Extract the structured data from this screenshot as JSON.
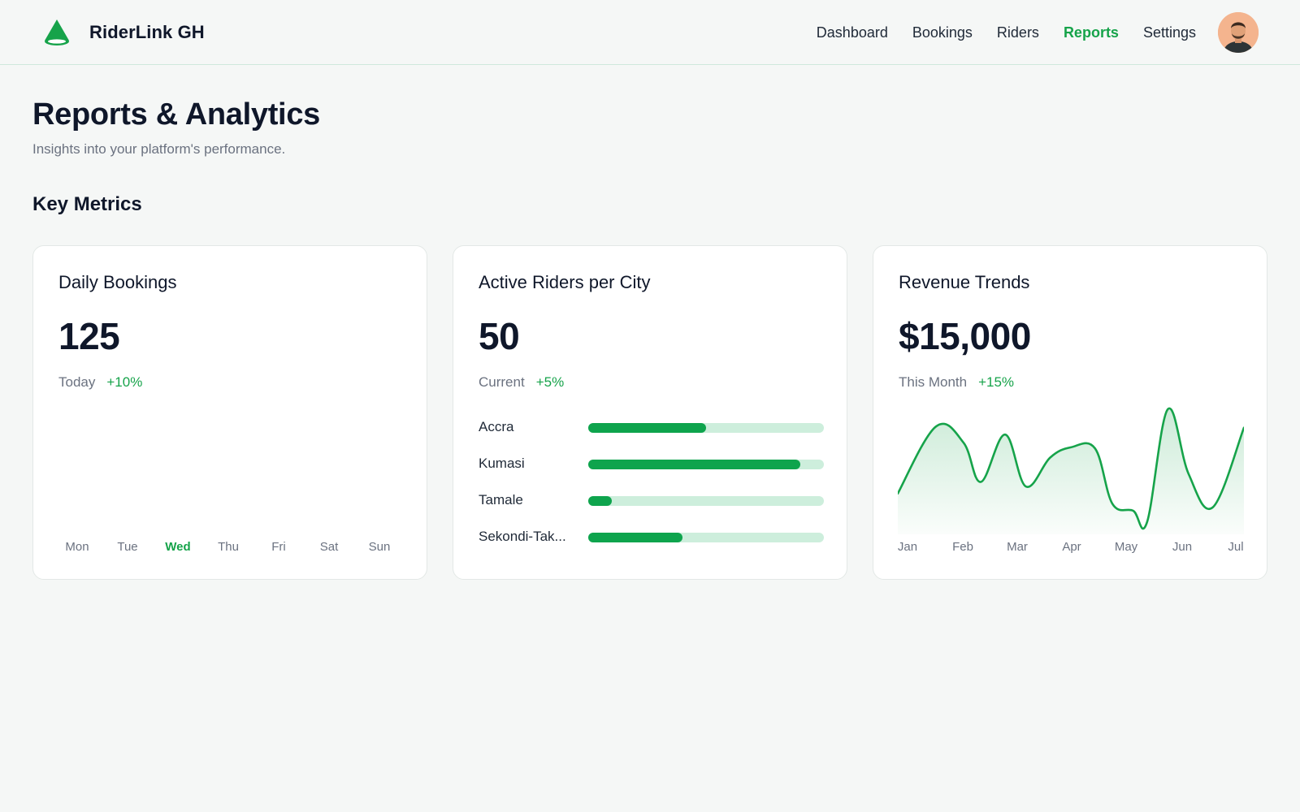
{
  "header": {
    "brand_name": "RiderLink GH",
    "nav": [
      {
        "label": "Dashboard",
        "active": false
      },
      {
        "label": "Bookings",
        "active": false
      },
      {
        "label": "Riders",
        "active": false
      },
      {
        "label": "Reports",
        "active": true
      },
      {
        "label": "Settings",
        "active": false
      }
    ],
    "accent_color": "#16a34a"
  },
  "page": {
    "title": "Reports & Analytics",
    "subtitle": "Insights into your platform's performance.",
    "section_title": "Key Metrics"
  },
  "cards": {
    "daily_bookings": {
      "title": "Daily Bookings",
      "value": "125",
      "period": "Today",
      "change": "+10%",
      "days": [
        "Mon",
        "Tue",
        "Wed",
        "Thu",
        "Fri",
        "Sat",
        "Sun"
      ],
      "active_day": "Wed"
    },
    "active_riders": {
      "title": "Active Riders per City",
      "value": "50",
      "period": "Current",
      "change": "+5%",
      "cities": [
        {
          "name": "Accra",
          "share": 0.5
        },
        {
          "name": "Kumasi",
          "share": 0.9
        },
        {
          "name": "Tamale",
          "share": 0.1
        },
        {
          "name": "Sekondi-Tak...",
          "share": 0.4
        }
      ]
    },
    "revenue": {
      "title": "Revenue Trends",
      "value": "$15,000",
      "period": "This Month",
      "change": "+15%"
    }
  },
  "chart_data": {
    "type": "area",
    "title": "Revenue Trends",
    "categories": [
      "Jan",
      "Feb",
      "Mar",
      "Apr",
      "May",
      "Jun",
      "Jul"
    ],
    "line_color": "#16a34a",
    "grid": false,
    "points": [
      {
        "x": 0.0,
        "y": 0.27
      },
      {
        "x": 0.11,
        "y": 0.85
      },
      {
        "x": 0.19,
        "y": 0.71
      },
      {
        "x": 0.24,
        "y": 0.37
      },
      {
        "x": 0.31,
        "y": 0.78
      },
      {
        "x": 0.37,
        "y": 0.33
      },
      {
        "x": 0.44,
        "y": 0.58
      },
      {
        "x": 0.5,
        "y": 0.67
      },
      {
        "x": 0.57,
        "y": 0.66
      },
      {
        "x": 0.62,
        "y": 0.18
      },
      {
        "x": 0.68,
        "y": 0.12
      },
      {
        "x": 0.72,
        "y": 0.02
      },
      {
        "x": 0.78,
        "y": 1.0
      },
      {
        "x": 0.84,
        "y": 0.44
      },
      {
        "x": 0.91,
        "y": 0.15
      },
      {
        "x": 1.0,
        "y": 0.84
      }
    ]
  }
}
